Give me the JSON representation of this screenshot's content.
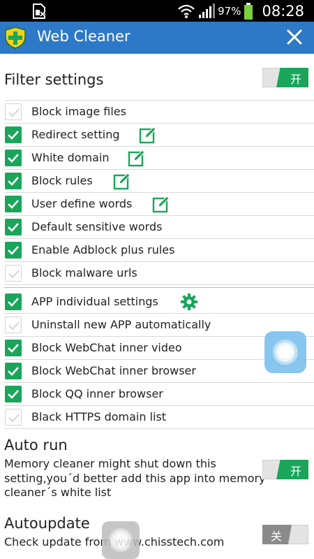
{
  "status_bar": {
    "battery_percent": "97%",
    "time": "08:28",
    "icons": [
      "no-sim-icon",
      "wifi-icon",
      "signal-icon",
      "battery-icon"
    ]
  },
  "title_bar": {
    "title": "Web Cleaner",
    "app_icon": "shield-icon",
    "close_icon": "close-icon"
  },
  "filter": {
    "title": "Filter settings",
    "toggle_label": "开",
    "toggle_on": true,
    "group1": [
      {
        "label": "Block image files",
        "checked": false
      },
      {
        "label": "Redirect setting",
        "checked": true,
        "icon": "edit-icon"
      },
      {
        "label": "White domain",
        "checked": true,
        "icon": "edit-icon"
      },
      {
        "label": "Block rules",
        "checked": true,
        "icon": "edit-icon"
      },
      {
        "label": "User define words",
        "checked": true,
        "icon": "edit-icon"
      },
      {
        "label": "Default sensitive words",
        "checked": true
      },
      {
        "label": "Enable Adblock plus rules",
        "checked": true
      },
      {
        "label": "Block malware urls",
        "checked": false
      }
    ],
    "group2": [
      {
        "label": "APP individual settings",
        "checked": true,
        "icon": "gear-icon"
      },
      {
        "label": "Uninstall new APP automatically",
        "checked": false
      },
      {
        "label": "Block WebChat inner video",
        "checked": true
      },
      {
        "label": "Block WebChat inner browser",
        "checked": true
      },
      {
        "label": "Block QQ inner browser",
        "checked": true
      },
      {
        "label": "Black HTTPS domain list",
        "checked": false
      }
    ]
  },
  "auto_run": {
    "title": "Auto run",
    "description": [
      "Memory cleaner might shut down this",
      "setting,you´d better add this app into memory",
      "cleaner´s white list"
    ],
    "toggle_label": "开",
    "toggle_on": true
  },
  "autoupdate": {
    "title": "Autoupdate",
    "description": "Check update from www.chisstech.com",
    "toggle_label": "关",
    "toggle_on": false
  },
  "colors": {
    "accent": "#1aa55b",
    "title_bar": "#2d79c8",
    "status_bar": "#000000"
  }
}
